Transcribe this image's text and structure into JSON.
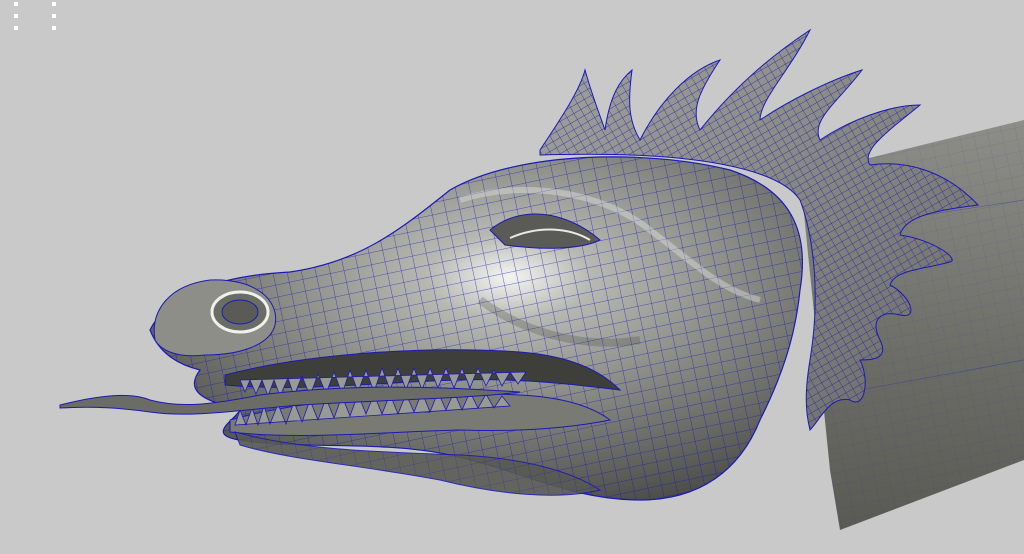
{
  "viewport": {
    "background": "#c9c9c9",
    "mesh_color": "#1a1ab8",
    "surface_color": "#8a8a86",
    "highlight_color": "#f4f4f2",
    "shadow_color": "#3e3e3a"
  },
  "corner_marker": {
    "icon": "viewport-grip-icon"
  },
  "model": {
    "icon": "wireframe-dragon-head-icon"
  }
}
